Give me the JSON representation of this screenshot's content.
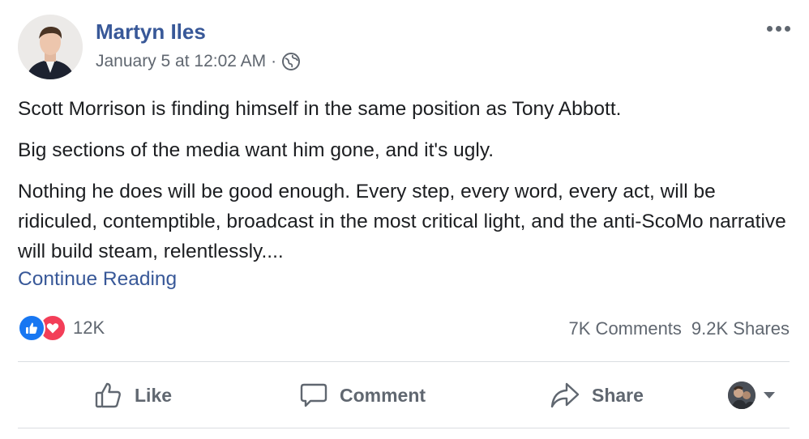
{
  "post": {
    "author": "Martyn Iles",
    "timestamp": "January 5 at 12:02 AM",
    "separator": "·",
    "privacy_icon": "globe-icon",
    "more_icon": "more-options-icon",
    "paragraphs": [
      "Scott Morrison is finding himself in the same position as Tony Abbott.",
      "Big sections of the media want him gone, and it's ugly.",
      "Nothing he does will be good enough. Every step, every word, every act, will be ridiculed, contemptible, broadcast in the most critical light, and the anti-ScoMo narrative will build steam, relentlessly...."
    ],
    "continue_label": "Continue Reading"
  },
  "stats": {
    "reaction_icons": [
      "like-reaction-icon",
      "love-reaction-icon"
    ],
    "reaction_count": "12K",
    "comments": "7K Comments",
    "shares": "9.2K Shares"
  },
  "actions": {
    "like": "Like",
    "comment": "Comment",
    "share": "Share"
  },
  "colors": {
    "link": "#385898",
    "muted": "#606770",
    "like_blue": "#1877f2",
    "love_red": "#f33e58",
    "divider": "#dadde1"
  }
}
